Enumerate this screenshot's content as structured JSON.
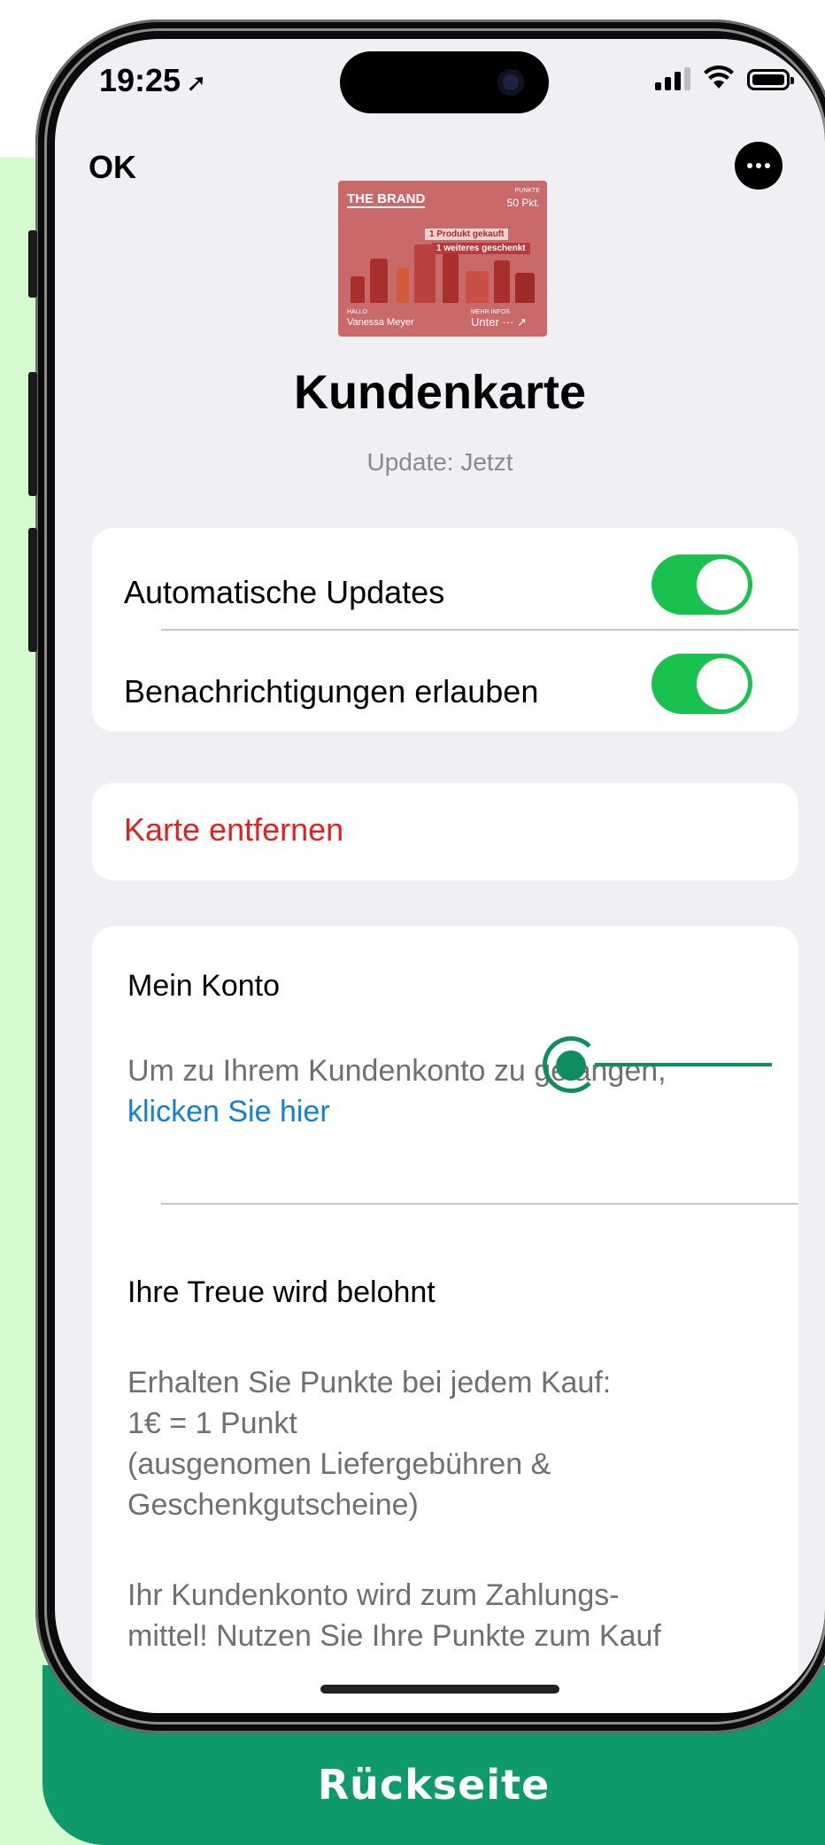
{
  "status_bar": {
    "time": "19:25",
    "location_arrow": "location-arrow-icon"
  },
  "nav": {
    "ok_label": "OK",
    "more_icon": "ellipsis-circle-icon"
  },
  "card": {
    "brand": "THE BRAND",
    "points_label": "PUNKTE",
    "points_value": "50 Pkt.",
    "promo_line1": "1 Produkt gekauft",
    "promo_line2": "1 weiteres geschenkt",
    "hello_label": "HALLO",
    "holder_name": "Vanessa Meyer",
    "info_label": "MEHR INFOS",
    "info_value": "Unter ··· ↗"
  },
  "header": {
    "title": "Kundenkarte",
    "subtitle": "Update: Jetzt"
  },
  "settings": {
    "auto_updates_label": "Automatische Updates",
    "auto_updates_on": true,
    "notifications_label": "Benachrichtigungen erlauben",
    "notifications_on": true
  },
  "remove_card_label": "Karte entfernen",
  "account": {
    "title": "Mein Konto",
    "text": "Um zu Ihrem Kundenkonto zu gelangen,",
    "link": "klicken Sie hier"
  },
  "loyalty": {
    "title": "Ihre Treue wird belohnt",
    "line1": "Erhalten Sie Punkte bei jedem Kauf:",
    "line2": "1€ = 1 Punkt",
    "line3": "(ausgenomen Liefergebühren &",
    "line4": "Geschenkgutscheine)",
    "line5": "Ihr Kundenkonto wird zum Zahlungs-",
    "line6": "mittel! Nutzen Sie Ihre Punkte zum Kauf"
  },
  "caption": "Rückseite",
  "colors": {
    "accent_green": "#0e9a6a",
    "toggle_green": "#19c24e",
    "link_blue": "#1380d6",
    "destructive_red": "#e02222",
    "mint_bg": "#d6fbd0"
  }
}
